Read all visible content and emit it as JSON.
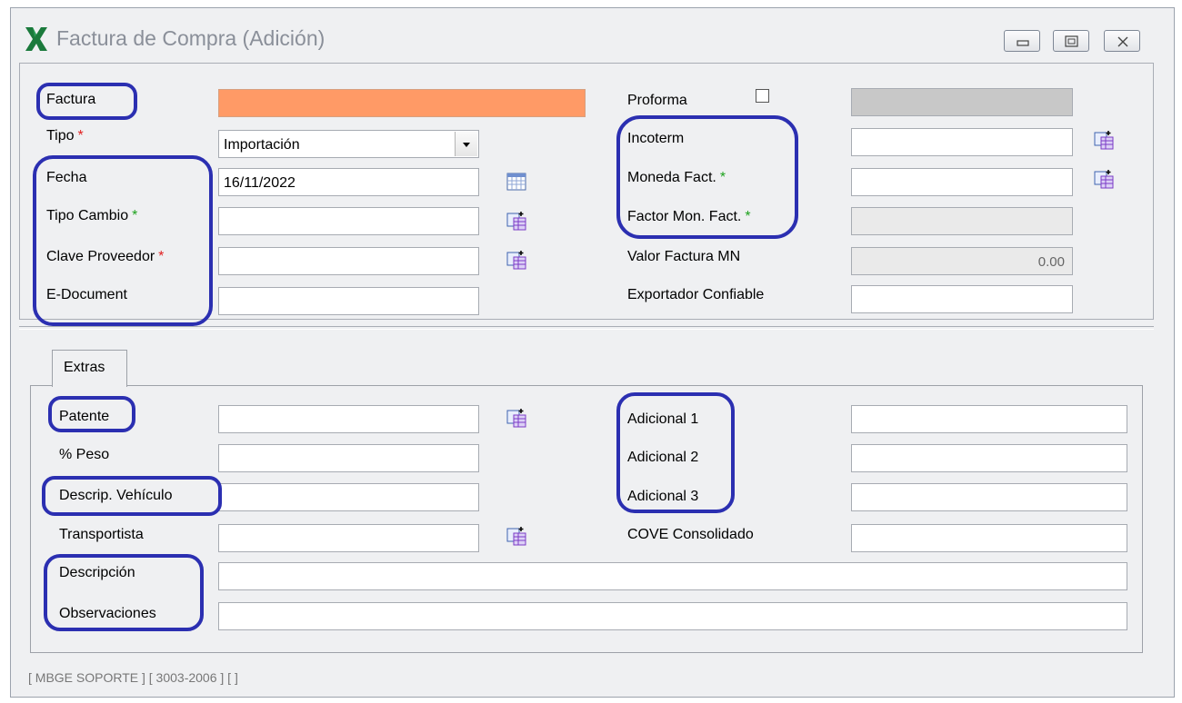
{
  "window": {
    "title": "Factura de Compra (Adición)",
    "app_icon": "x-logo-icon"
  },
  "header_form": {
    "factura": {
      "label": "Factura",
      "value": ""
    },
    "tipo": {
      "label": "Tipo",
      "required": "*",
      "value": "Importación"
    },
    "fecha": {
      "label": "Fecha",
      "value": "16/11/2022"
    },
    "tipo_cambio": {
      "label": "Tipo Cambio",
      "required": "*",
      "value": ""
    },
    "clave_proveedor": {
      "label": "Clave Proveedor",
      "required": "*",
      "value": ""
    },
    "e_document": {
      "label": "E-Document",
      "value": ""
    },
    "proforma": {
      "label": "Proforma",
      "checked": false,
      "value": ""
    },
    "incoterm": {
      "label": "Incoterm",
      "value": ""
    },
    "moneda_fact": {
      "label": "Moneda Fact.",
      "required": "*",
      "value": ""
    },
    "factor_mon_fact": {
      "label": "Factor Mon. Fact.",
      "required": "*",
      "value": ""
    },
    "valor_factura_mn": {
      "label": "Valor Factura MN",
      "value": "0.00"
    },
    "exportador_confiable": {
      "label": "Exportador Confiable",
      "value": ""
    }
  },
  "tabs": [
    {
      "label": "Extras"
    }
  ],
  "extras": {
    "patente": {
      "label": "Patente",
      "value": ""
    },
    "peso": {
      "label": "% Peso",
      "value": ""
    },
    "descrip_vehiculo": {
      "label": "Descrip. Vehículo",
      "value": ""
    },
    "transportista": {
      "label": "Transportista",
      "value": ""
    },
    "descripcion": {
      "label": "Descripción",
      "value": ""
    },
    "observaciones": {
      "label": "Observaciones",
      "value": ""
    },
    "adicional1": {
      "label": "Adicional 1",
      "value": ""
    },
    "adicional2": {
      "label": "Adicional 2",
      "value": ""
    },
    "adicional3": {
      "label": "Adicional 3",
      "value": ""
    },
    "cove_consolidado": {
      "label": "COVE Consolidado",
      "value": ""
    }
  },
  "status_bar": "[ MBGE SOPORTE ]  [ 3003-2006 ]  [  ]",
  "colors": {
    "highlight_oval": "#2b2fb1",
    "factura_field": "#ff9a66",
    "required_red": "#e02020",
    "required_green": "#1da21d"
  }
}
